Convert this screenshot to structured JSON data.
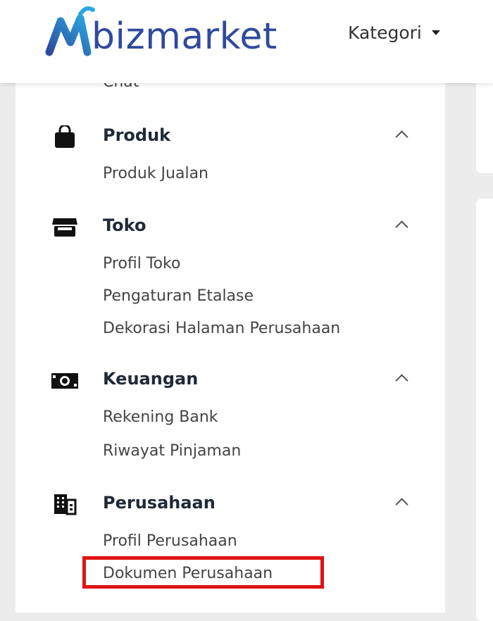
{
  "header": {
    "logo_text": "bizmarket",
    "kategori_label": "Kategori"
  },
  "sidebar": {
    "chat_label": "Chat",
    "sections": [
      {
        "title": "Produk",
        "icon": "shopping-bag-icon",
        "items": [
          "Produk Jualan"
        ]
      },
      {
        "title": "Toko",
        "icon": "store-icon",
        "items": [
          "Profil Toko",
          "Pengaturan Etalase",
          "Dekorasi Halaman Perusahaan"
        ]
      },
      {
        "title": "Keuangan",
        "icon": "money-icon",
        "items": [
          "Rekening Bank",
          "Riwayat Pinjaman"
        ]
      },
      {
        "title": "Perusahaan",
        "icon": "building-icon",
        "items": [
          "Profil Perusahaan",
          "Dokumen Perusahaan"
        ]
      }
    ]
  },
  "colors": {
    "brand": "#2f4a9e",
    "logo_accent": "#2aa6e0",
    "highlight": "#e01313"
  }
}
